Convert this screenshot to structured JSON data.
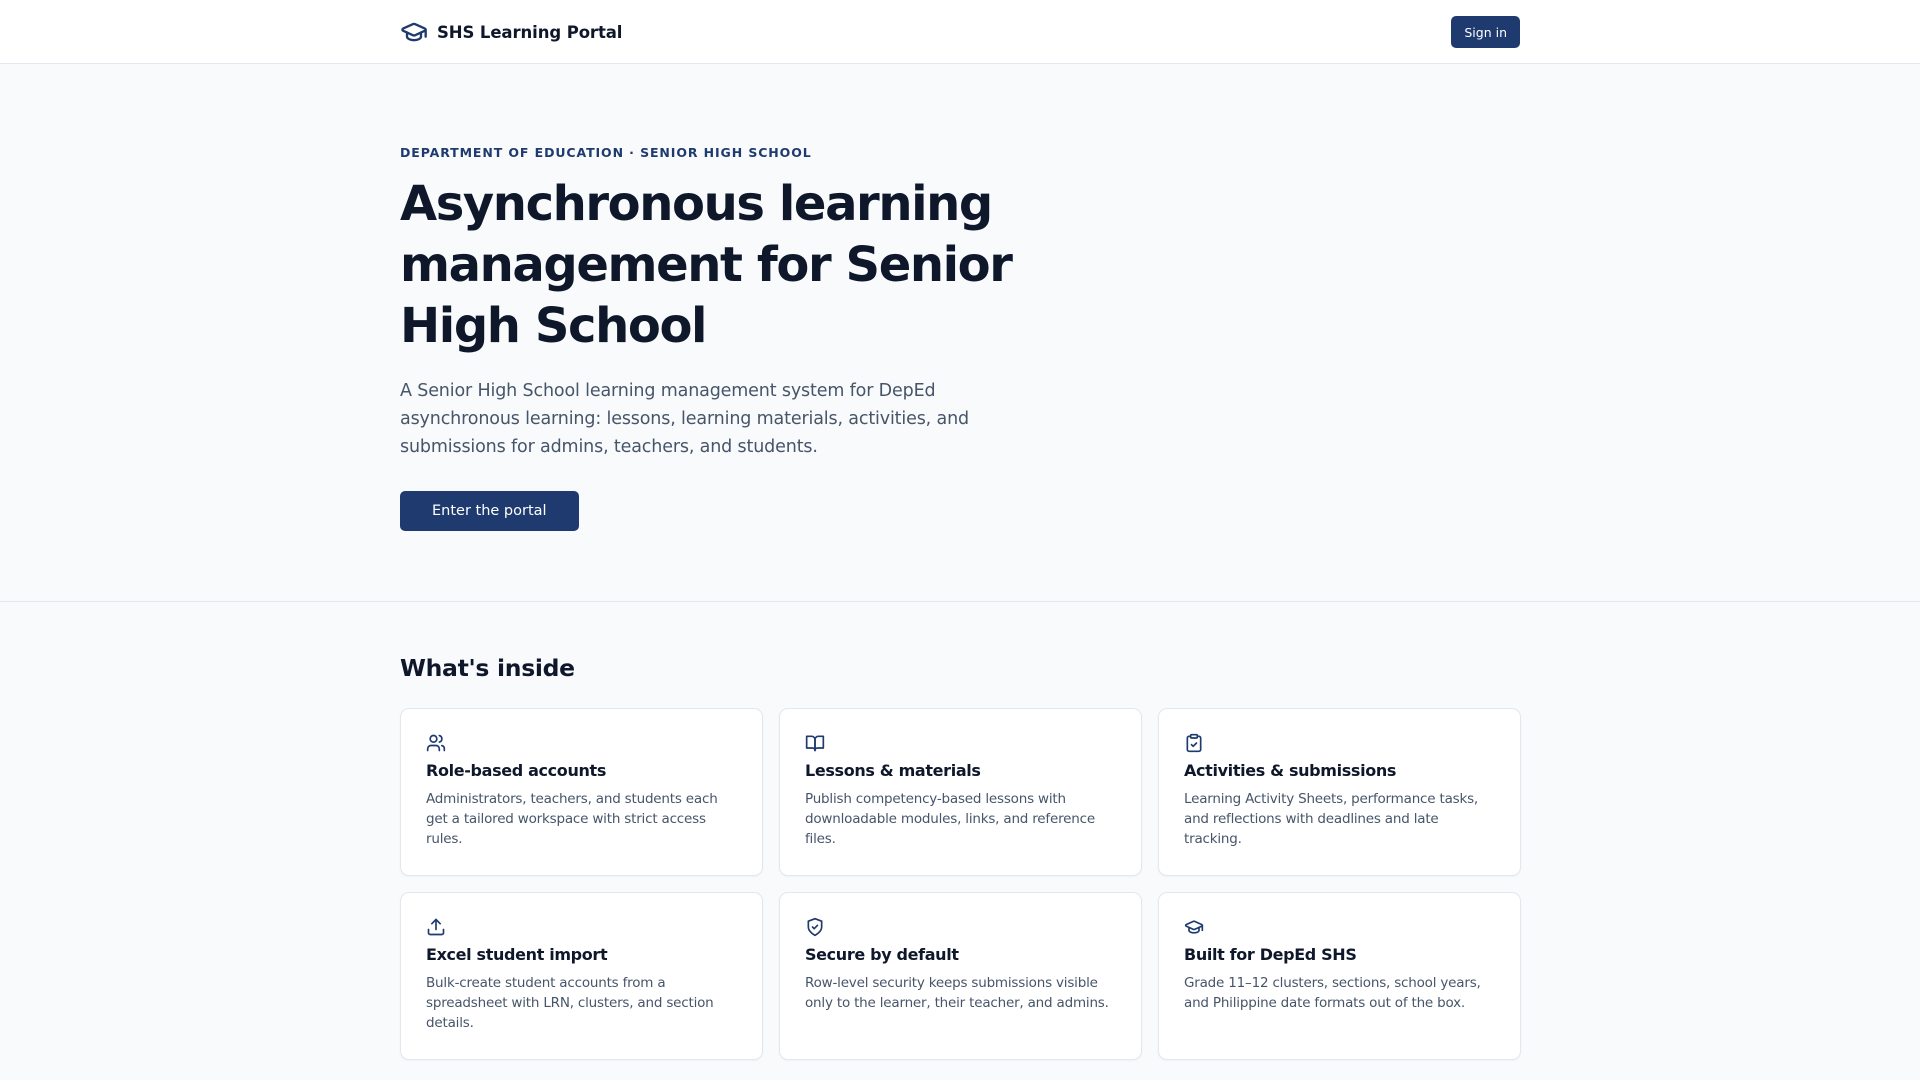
{
  "header": {
    "brand_icon": "graduation-cap-icon",
    "brand_name": "SHS Learning Portal",
    "sign_in_label": "Sign in"
  },
  "hero": {
    "eyebrow": "Department of Education · Senior High School",
    "title": "Asynchronous learning management for Senior High School",
    "description": "A Senior High School learning management system for DepEd asynchronous learning: lessons, learning materials, activities, and submissions for admins, teachers, and students.",
    "cta_label": "Enter the portal"
  },
  "features": {
    "heading": "What's inside",
    "items": [
      {
        "icon": "users-icon",
        "title": "Role-based accounts",
        "description": "Administrators, teachers, and students each get a tailored workspace with strict access rules."
      },
      {
        "icon": "book-open-icon",
        "title": "Lessons & materials",
        "description": "Publish competency-based lessons with downloadable modules, links, and reference files."
      },
      {
        "icon": "clipboard-check-icon",
        "title": "Activities & submissions",
        "description": "Learning Activity Sheets, performance tasks, and reflections with deadlines and late tracking."
      },
      {
        "icon": "upload-icon",
        "title": "Excel student import",
        "description": "Bulk-create student accounts from a spreadsheet with LRN, clusters, and section details."
      },
      {
        "icon": "shield-check-icon",
        "title": "Secure by default",
        "description": "Row-level security keeps submissions visible only to the learner, their teacher, and admins."
      },
      {
        "icon": "graduation-cap-icon",
        "title": "Built for DepEd SHS",
        "description": "Grade 11–12 clusters, sections, school years, and Philippine date formats out of the box."
      }
    ]
  },
  "colors": {
    "primary": "#1e3a6e",
    "text": "#0f172a",
    "muted": "#475569",
    "background": "#f8fafc",
    "border": "#e2e8f0"
  }
}
